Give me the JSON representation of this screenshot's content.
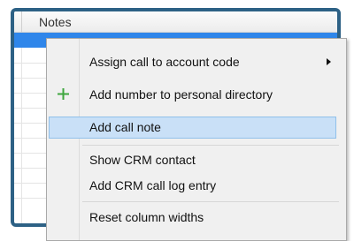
{
  "table": {
    "column_header": "Notes"
  },
  "context_menu": {
    "items": [
      {
        "label": "Assign call to account code",
        "has_submenu": true,
        "highlighted": false,
        "icon": ""
      },
      {
        "label": "Add number to personal directory",
        "has_submenu": false,
        "highlighted": false,
        "icon": "plus-icon"
      },
      {
        "label": "Add call note",
        "has_submenu": false,
        "highlighted": true,
        "icon": ""
      },
      {
        "label": "Show CRM contact",
        "has_submenu": false,
        "highlighted": false,
        "icon": ""
      },
      {
        "label": "Add CRM call log entry",
        "has_submenu": false,
        "highlighted": false,
        "icon": ""
      },
      {
        "label": "Reset column widths",
        "has_submenu": false,
        "highlighted": false,
        "icon": ""
      }
    ]
  },
  "colors": {
    "frame_border": "#2d6185",
    "selected_row": "#2f86ea",
    "highlight": "#c9e0f7",
    "plus_icon": "#3ea63e"
  }
}
